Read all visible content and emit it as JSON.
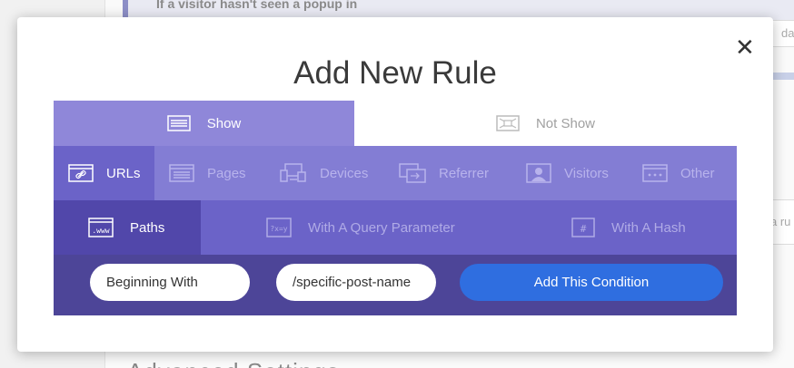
{
  "background": {
    "top_text": "If a visitor hasn't seen a popup in",
    "right_input_text": "da",
    "right_input2_text": "a ru",
    "bottom_text": "Advanced Settings"
  },
  "modal": {
    "title": "Add New Rule",
    "close_glyph": "✕",
    "show_tabs": [
      {
        "label": "Show",
        "icon": "window-icon",
        "active": true
      },
      {
        "label": "Not Show",
        "icon": "window-x-icon",
        "active": false
      }
    ],
    "categories": [
      {
        "label": "URLs",
        "icon": "link-window-icon",
        "active": true
      },
      {
        "label": "Pages",
        "icon": "pages-icon",
        "active": false
      },
      {
        "label": "Devices",
        "icon": "devices-icon",
        "active": false
      },
      {
        "label": "Referrer",
        "icon": "referrer-icon",
        "active": false
      },
      {
        "label": "Visitors",
        "icon": "visitor-icon",
        "active": false
      },
      {
        "label": "Other",
        "icon": "dots-window-icon",
        "active": false
      }
    ],
    "sub_tabs": [
      {
        "label": "Paths",
        "icon": "www-icon",
        "active": true
      },
      {
        "label": "With A Query Parameter",
        "icon": "query-icon",
        "active": false
      },
      {
        "label": "With A Hash",
        "icon": "hash-icon",
        "active": false
      }
    ],
    "condition": {
      "match_select": "Beginning With",
      "path_value": "/specific-post-name",
      "add_button": "Add This Condition"
    }
  },
  "colors": {
    "show_tab": "#8f87d9",
    "category_row": "#837dd4",
    "sub_row": "#6b63c8",
    "condition_row": "#4d4598",
    "add_button": "#2f6ee0"
  }
}
